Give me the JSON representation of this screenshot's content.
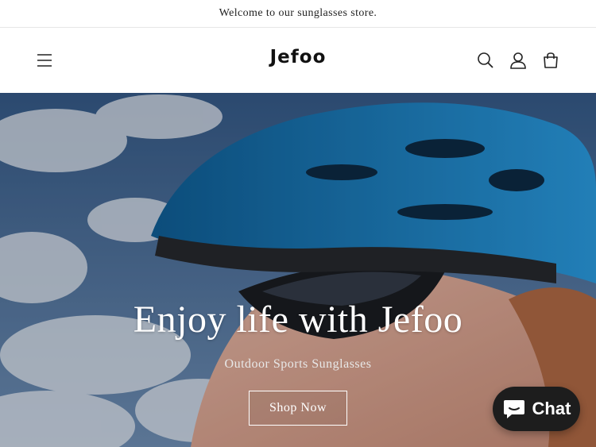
{
  "announcement": {
    "text": "Welcome to our sunglasses store."
  },
  "header": {
    "logo": "Jefoo",
    "menu_icon": "hamburger-menu-icon",
    "search_icon": "search-icon",
    "account_icon": "user-icon",
    "cart_icon": "cart-bag-icon"
  },
  "hero": {
    "title": "Enjoy life with Jefoo",
    "subtitle": "Outdoor Sports Sunglasses",
    "cta_label": "Shop Now"
  },
  "chat_widget": {
    "label": "Chat",
    "icon": "chat-bubble-icon"
  },
  "colors": {
    "helmet_blue": "#1e88c8",
    "sky": "#4a6e9c",
    "chat_bg": "#1d1d1d"
  }
}
